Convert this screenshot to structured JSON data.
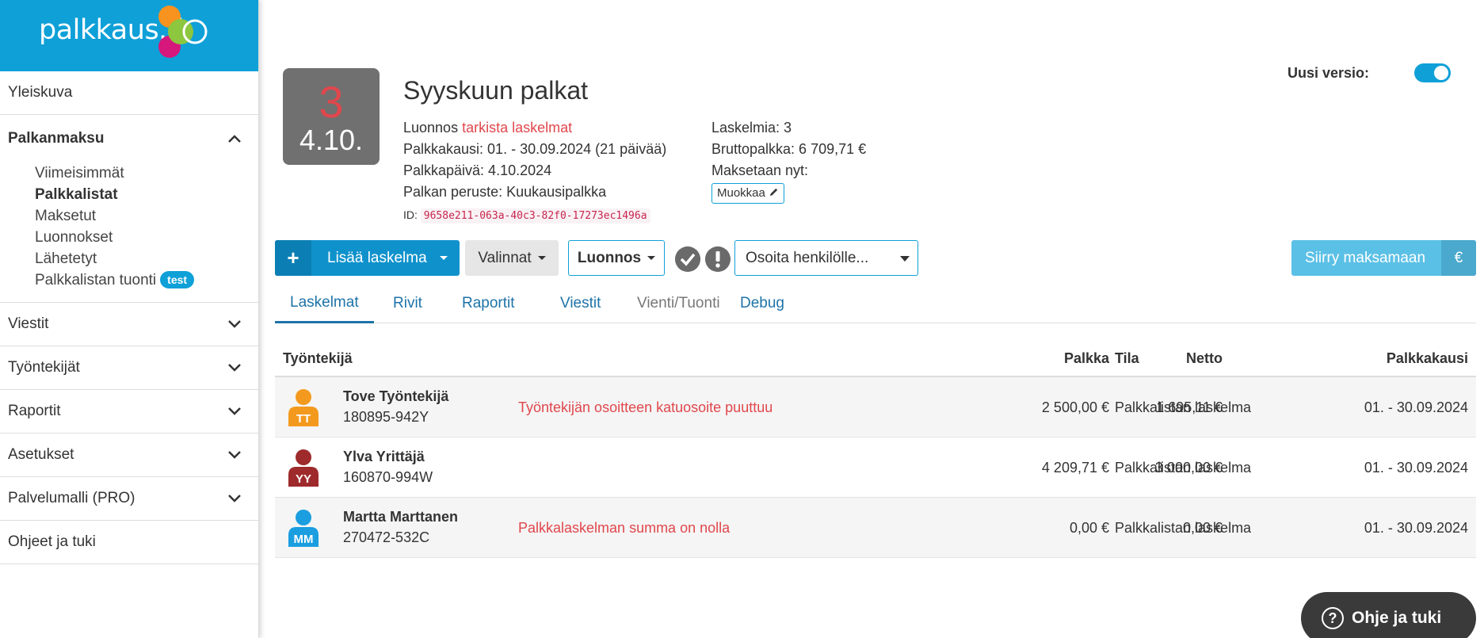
{
  "brand": {
    "logo_text": "palkkaus.fi"
  },
  "sidebar": {
    "overview": "Yleiskuva",
    "payroll": {
      "label": "Palkanmaksu",
      "items": [
        "Viimeisimmät",
        "Palkkalistat",
        "Maksetut",
        "Luonnokset",
        "Lähetetyt",
        "Palkkalistan tuonti"
      ],
      "badge": "test"
    },
    "groups": [
      "Viestit",
      "Työntekijät",
      "Raportit",
      "Asetukset",
      "Palvelumalli (PRO)"
    ],
    "help": "Ohjeet ja tuki"
  },
  "header": {
    "date_number": "3",
    "date_label": "4.10.",
    "title": "Syyskuun palkat",
    "status_prefix": "Luonnos",
    "status_warning": "tarkista laskelmat",
    "period": "Palkkakausi: 01. - 30.09.2024 (21 päivää)",
    "payday": "Palkkapäivä: 4.10.2024",
    "basis": "Palkan peruste: Kuukausipalkka",
    "id_label": "ID:",
    "id_value": "9658e211-063a-40c3-82f0-17273ec1496a",
    "calc_count": "Laskelmia: 3",
    "gross": "Bruttopalkka: 6 709,71 €",
    "paid_now": "Maksetaan nyt:",
    "edit_label": "Muokkaa"
  },
  "version_toggle": {
    "label": "Uusi versio:",
    "on": true
  },
  "toolbar": {
    "add_label": "Lisää laskelma",
    "options_label": "Valinnat",
    "draft_label": "Luonnos",
    "assign_placeholder": "Osoita henkilölle...",
    "pay_label": "Siirry maksamaan",
    "pay_icon": "€"
  },
  "tabs": [
    "Laskelmat",
    "Rivit",
    "Raportit",
    "Viestit",
    "Vienti/Tuonti",
    "Debug"
  ],
  "table": {
    "headers": {
      "employee": "Työntekijä",
      "salary": "Palkka",
      "net": "Netto",
      "status": "Tila",
      "period": "Palkkakausi"
    },
    "rows": [
      {
        "initials": "TT",
        "color": "#f39a1e",
        "name": "Tove Työntekijä",
        "ssn": "180895-942Y",
        "message": "Työntekijän osoitteen katuosoite puuttuu",
        "salary": "2 500,00 €",
        "net": "1 695,11 €",
        "status": "Palkkalistan laskelma",
        "period": "01. - 30.09.2024"
      },
      {
        "initials": "YY",
        "color": "#9e2a2b",
        "name": "Ylva Yrittäjä",
        "ssn": "160870-994W",
        "message": "",
        "salary": "4 209,71 €",
        "net": "3 000,00 €",
        "status": "Palkkalistan laskelma",
        "period": "01. - 30.09.2024"
      },
      {
        "initials": "MM",
        "color": "#1a9ee0",
        "name": "Martta Marttanen",
        "ssn": "270472-532C",
        "message": "Palkkalaskelman summa on nolla",
        "salary": "0,00 €",
        "net": "0,00 €",
        "status": "Palkkalistan laskelma",
        "period": "01. - 30.09.2024"
      }
    ]
  },
  "help_button": {
    "label": "Ohje ja tuki",
    "icon": "?"
  },
  "colors": {
    "brand_blue": "#0fa0d8",
    "warning_red": "#e0474c",
    "date_box": "#707070"
  }
}
